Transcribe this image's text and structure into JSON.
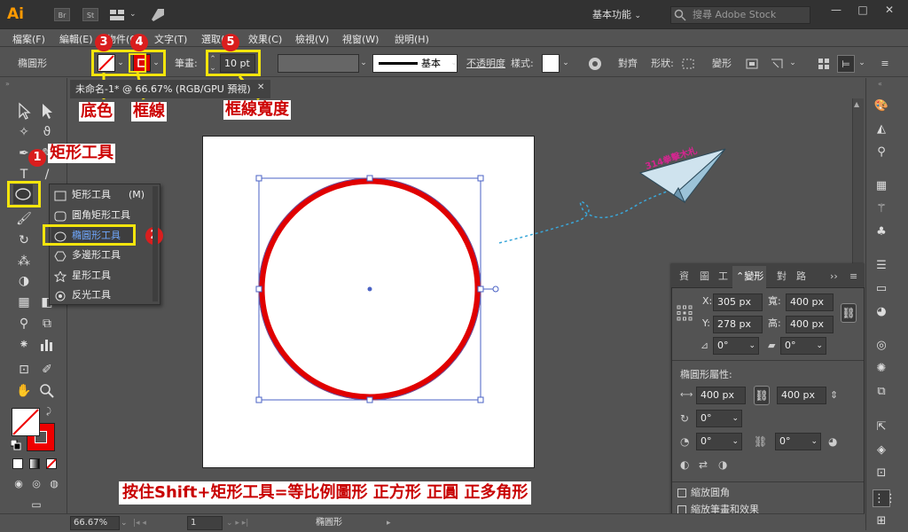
{
  "titlebar": {
    "app_logo": "Ai",
    "badge_br": "Br",
    "badge_st": "St",
    "workspace": "基本功能",
    "stock_search_placeholder": "搜尋 Adobe Stock",
    "minimize": "—",
    "maximize": "□",
    "close": "✕"
  },
  "menu": {
    "items": [
      "檔案(F)",
      "編輯(E)",
      "物件(O)",
      "文字(T)",
      "選取(S)",
      "效果(C)",
      "檢視(V)",
      "視窗(W)",
      "說明(H)"
    ]
  },
  "control": {
    "object_type": "橢圓形",
    "stroke_label": "筆畫:",
    "stroke_weight": "10 pt",
    "stroke_profile": "基本",
    "opacity_label": "不透明度",
    "style_label": "樣式:",
    "align_label": "對齊",
    "shape_label": "形狀:",
    "transform_label": "變形"
  },
  "annotations": {
    "fill_color": "底色",
    "stroke": "框線",
    "stroke_width": "框線寬度",
    "rect_tool": "矩形工具",
    "num_1": "1",
    "num_2": "2",
    "num_3": "3",
    "num_4": "4",
    "num_5": "5",
    "bottom_note": "按住Shift+矩形工具=等比例圖形 正方形 正圓 正多角形",
    "plane_text": "314拳擊木札"
  },
  "document": {
    "tab_title": "未命名-1* @ 66.67% (RGB/GPU 預視)",
    "tab_close": "✕"
  },
  "flyout": {
    "items": [
      {
        "label": "矩形工具",
        "shortcut": "(M)"
      },
      {
        "label": "圓角矩形工具",
        "shortcut": ""
      },
      {
        "label": "橢圓形工具",
        "shortcut": ""
      },
      {
        "label": "多邊形工具",
        "shortcut": ""
      },
      {
        "label": "星形工具",
        "shortcut": ""
      },
      {
        "label": "反光工具",
        "shortcut": ""
      }
    ]
  },
  "transform_panel": {
    "tabs": [
      "資",
      "圖",
      "工",
      "變形",
      "對",
      "路"
    ],
    "active_tab": "變形",
    "x_label": "X:",
    "x_value": "305 px",
    "y_label": "Y:",
    "y_value": "278 px",
    "w_label": "寬:",
    "w_value": "400 px",
    "h_label": "高:",
    "h_value": "400 px",
    "angle_value": "0°",
    "shear_value": "0°",
    "ellipse_props_title": "橢圓形屬性:",
    "ellipse_w": "400 px",
    "ellipse_h": "400 px",
    "pie_angle": "0°",
    "pie_start": "0°",
    "pie_end": "0°",
    "scale_corners": "縮放圓角",
    "scale_strokes": "縮放筆畫和效果"
  },
  "status": {
    "zoom": "66.67%",
    "artboard": "1",
    "tool_name": "橢圓形"
  },
  "colors": {
    "accent_yellow": "#f5e50c",
    "annotation_red": "#c00000",
    "circle_stroke": "#e00000",
    "selection_blue": "#4a62c4"
  }
}
